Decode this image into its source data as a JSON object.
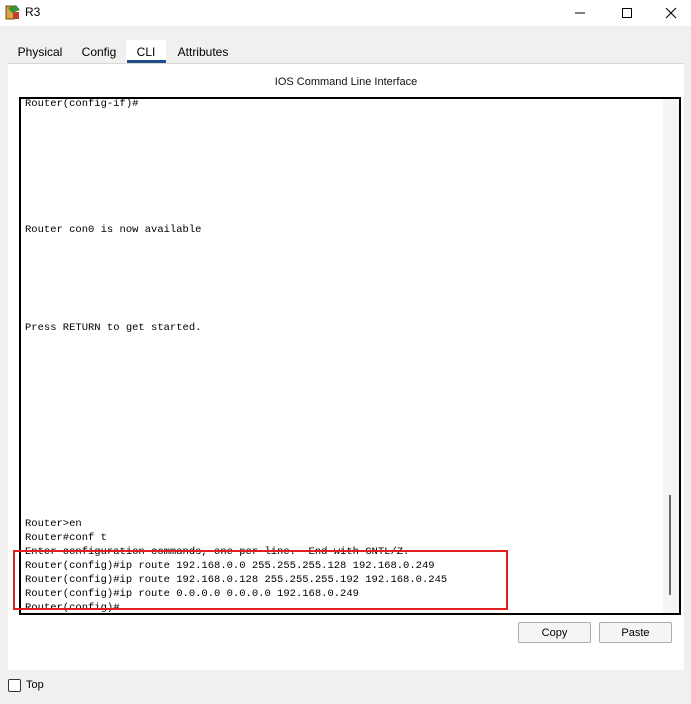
{
  "window": {
    "title": "R3",
    "icon": "router-app-icon",
    "controls": [
      "minimize-icon",
      "maximize-icon",
      "close-icon"
    ]
  },
  "tabs": [
    {
      "label": "Physical",
      "active": false
    },
    {
      "label": "Config",
      "active": false
    },
    {
      "label": "CLI",
      "active": true
    },
    {
      "label": "Attributes",
      "active": false
    }
  ],
  "panel": {
    "heading": "IOS Command Line Interface"
  },
  "terminal": {
    "lines": [
      "Router(config-if)#",
      "Router con0 is now available",
      "Press RETURN to get started.",
      "Router>en",
      "Router#conf t",
      "Enter configuration commands, one per line.  End with CNTL/Z.",
      "Router(config)#ip route 192.168.0.0 255.255.255.128 192.168.0.249",
      "Router(config)#ip route 192.168.0.128 255.255.255.192 192.168.0.245",
      "Router(config)#ip route 0.0.0.0 0.0.0.0 192.168.0.249",
      "Router(config)#"
    ]
  },
  "buttons": {
    "copy": "Copy",
    "paste": "Paste"
  },
  "footer": {
    "top_label": "Top",
    "top_checked": false
  },
  "colors": {
    "highlight": "#e02020",
    "active_tab_underline": "#1f4f8a"
  }
}
